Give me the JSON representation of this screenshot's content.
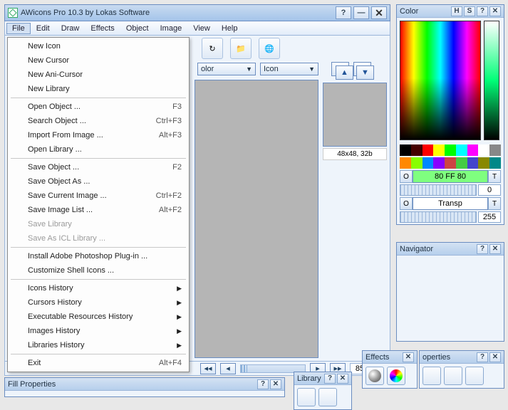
{
  "window": {
    "title": "AWicons Pro 10.3 by Lokas Software"
  },
  "menubar": [
    "File",
    "Edit",
    "Draw",
    "Effects",
    "Object",
    "Image",
    "View",
    "Help"
  ],
  "file_menu": {
    "groups": [
      [
        {
          "label": "New Icon"
        },
        {
          "label": "New Cursor"
        },
        {
          "label": "New Ani-Cursor"
        },
        {
          "label": "New Library"
        }
      ],
      [
        {
          "label": "Open Object ...",
          "shortcut": "F3"
        },
        {
          "label": "Search Object ...",
          "shortcut": "Ctrl+F3"
        },
        {
          "label": "Import From Image ...",
          "shortcut": "Alt+F3"
        },
        {
          "label": "Open Library ..."
        }
      ],
      [
        {
          "label": "Save Object ...",
          "shortcut": "F2"
        },
        {
          "label": "Save Object As ..."
        },
        {
          "label": "Save Current Image ...",
          "shortcut": "Ctrl+F2"
        },
        {
          "label": "Save Image List ...",
          "shortcut": "Alt+F2"
        },
        {
          "label": "Save Library",
          "disabled": true
        },
        {
          "label": "Save As ICL Library ...",
          "disabled": true
        }
      ],
      [
        {
          "label": "Install Adobe Photoshop Plug-in ..."
        },
        {
          "label": "Customize Shell Icons ..."
        }
      ],
      [
        {
          "label": "Icons History",
          "submenu": true
        },
        {
          "label": "Cursors History",
          "submenu": true
        },
        {
          "label": "Executable Resources History",
          "submenu": true
        },
        {
          "label": "Images History",
          "submenu": true
        },
        {
          "label": "Libraries History",
          "submenu": true
        }
      ],
      [
        {
          "label": "Exit",
          "shortcut": "Alt+F4"
        }
      ]
    ]
  },
  "combo1": "olor",
  "combo2": "Icon",
  "preview_label": "48x48, 32b",
  "zoom": {
    "value": "85",
    "percent": "%"
  },
  "panels": {
    "color": "Color",
    "navigator": "Navigator",
    "effects": "Effects",
    "properties": "operties",
    "fill": "Fill Properties",
    "library": "Library"
  },
  "color_panel": {
    "hex": "80 FF 80",
    "hex_o": "O",
    "hex_t": "T",
    "slider1": "0",
    "transp_label": "Transp",
    "transp_o": "O",
    "transp_t": "T",
    "slider2": "255",
    "head_h": "H",
    "head_s": "S"
  },
  "swatches1": [
    "#000",
    "#400",
    "#f00",
    "#ff0",
    "#0f0",
    "#0ff",
    "#f0f",
    "#fff",
    "#888"
  ],
  "swatches2": [
    "#f80",
    "#8f0",
    "#08f",
    "#80f",
    "#c44",
    "#4c4",
    "#44c",
    "#880",
    "#088"
  ]
}
